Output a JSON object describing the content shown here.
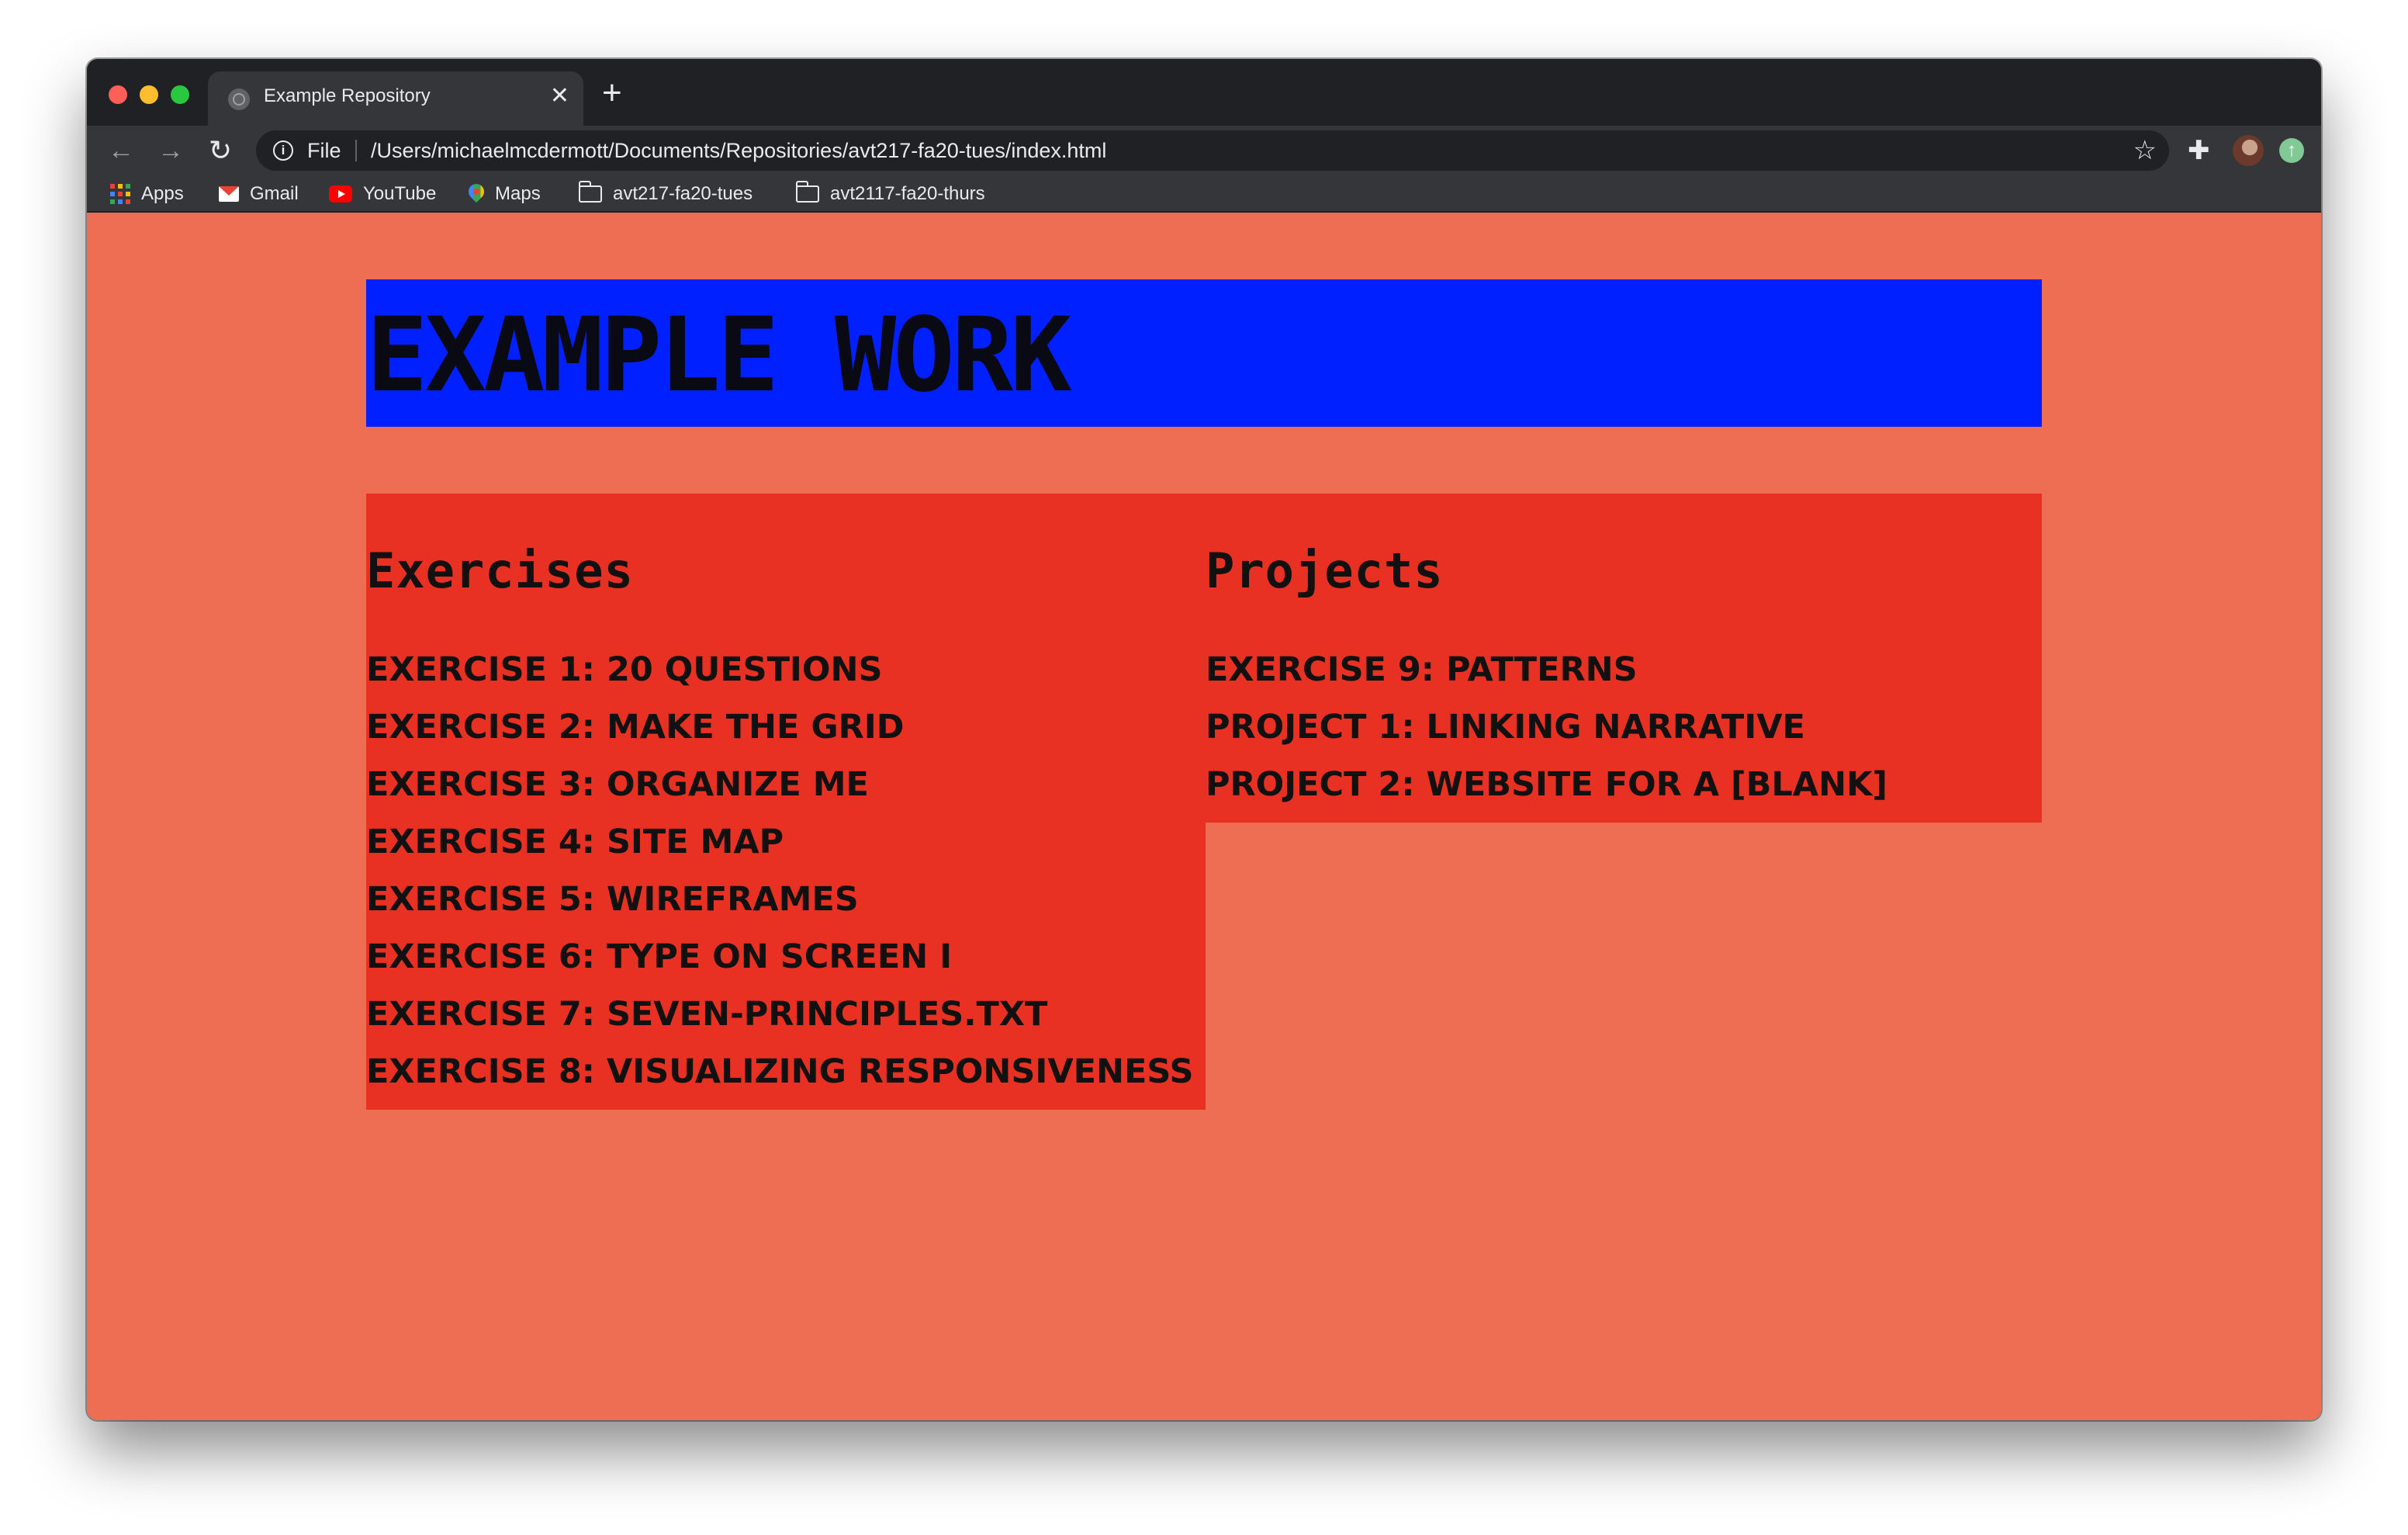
{
  "browser": {
    "tab_title": "Example Repository",
    "tab_close": "✕",
    "new_tab": "+",
    "scheme_label": "File",
    "url": "/Users/michaelmcdermott/Documents/Repositories/avt217-fa20-tues/index.html",
    "bookmarks": [
      {
        "label": "Apps",
        "icon": "apps-grid-icon"
      },
      {
        "label": "Gmail",
        "icon": "gmail-icon"
      },
      {
        "label": "YouTube",
        "icon": "youtube-icon"
      },
      {
        "label": "Maps",
        "icon": "maps-pin-icon"
      },
      {
        "label": "avt217-fa20-tues",
        "icon": "folder-icon"
      },
      {
        "label": "avt2117-fa20-thurs",
        "icon": "folder-icon"
      }
    ]
  },
  "page": {
    "title": "EXAMPLE WORK",
    "exercises": {
      "heading": "Exercises",
      "items": [
        "EXERCISE 1: 20 QUESTIONS",
        "EXERCISE 2: MAKE THE GRID",
        "EXERCISE 3: ORGANIZE ME",
        "EXERCISE 4: SITE MAP",
        "EXERCISE 5: WIREFRAMES",
        "EXERCISE 6: TYPE ON SCREEN I",
        "EXERCISE 7: SEVEN-PRINCIPLES.TXT",
        "EXERCISE 8: VISUALIZING RESPONSIVENESS"
      ]
    },
    "projects": {
      "heading": "Projects",
      "items": [
        "EXERCISE 9: PATTERNS",
        "PROJECT 1: LINKING NARRATIVE",
        "PROJECT 2: WEBSITE FOR A [BLANK]"
      ]
    }
  },
  "colors": {
    "page_background": "#ee6e53",
    "header_background": "#0020ff",
    "column_background": "#e93123",
    "text": "#111111"
  }
}
